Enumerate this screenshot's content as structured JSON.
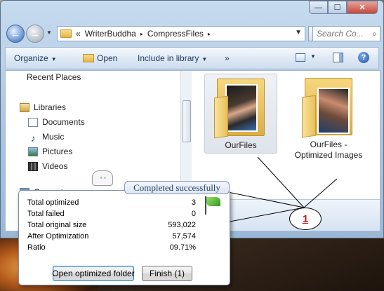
{
  "titlebar": {
    "minimize_glyph": "—",
    "maximize_glyph": "☐",
    "close_glyph": "✕"
  },
  "address_bar": {
    "overflow": "«",
    "crumbs": [
      "WriterBuddha",
      "CompressFiles"
    ],
    "separator": "▸",
    "search_placeholder": "Search Co..."
  },
  "command_bar": {
    "organize": "Organize",
    "open": "Open",
    "include_in_library": "Include in library",
    "more": "»"
  },
  "nav_pane": {
    "recent_places": "Recent Places",
    "libraries": "Libraries",
    "documents": "Documents",
    "music": "Music",
    "pictures": "Pictures",
    "videos": "Videos",
    "computer": "Computer"
  },
  "folders": [
    {
      "name": "OurFiles"
    },
    {
      "name": "OurFiles - Optimized Images"
    }
  ],
  "marker": {
    "label": "1"
  },
  "balloon": {
    "title": "Completed successfully",
    "stats": [
      {
        "label": "Total optimized",
        "value": "3"
      },
      {
        "label": "Total failed",
        "value": "0"
      },
      {
        "label": "Total original size",
        "value": "593,022"
      },
      {
        "label": "After Optimization",
        "value": "57,574"
      },
      {
        "label": "Ratio",
        "value": "09.71%"
      }
    ],
    "open_button": "Open optimized folder",
    "finish_button": "Finish (1)"
  },
  "colors": {
    "accent": "#1f3e6f",
    "marker_red": "#c0181f",
    "flag_green": "#2f9a20"
  }
}
